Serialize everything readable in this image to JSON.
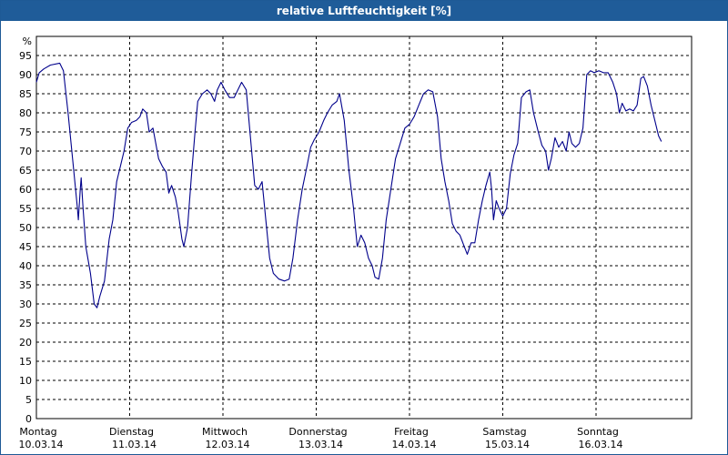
{
  "title": "relative Luftfeuchtigkeit [%]",
  "colors": {
    "titlebar": "#1f5c99",
    "line": "#00008b",
    "grid": "#000000"
  },
  "chart_data": {
    "type": "line",
    "title": "relative Luftfeuchtigkeit [%]",
    "ylabel": "%",
    "xlabel": "",
    "ylim": [
      0,
      100
    ],
    "yticks": [
      0,
      5,
      10,
      15,
      20,
      25,
      30,
      35,
      40,
      45,
      50,
      55,
      60,
      65,
      70,
      75,
      80,
      85,
      90,
      95
    ],
    "grid": true,
    "days": [
      {
        "weekday": "Montag",
        "date": "10.03.14"
      },
      {
        "weekday": "Dienstag",
        "date": "11.03.14"
      },
      {
        "weekday": "Mittwoch",
        "date": "12.03.14"
      },
      {
        "weekday": "Donnerstag",
        "date": "13.03.14"
      },
      {
        "weekday": "Freitag",
        "date": "14.03.14"
      },
      {
        "weekday": "Samstag",
        "date": "15.03.14"
      },
      {
        "weekday": "Sonntag",
        "date": "16.03.14"
      }
    ],
    "series": [
      {
        "points": [
          [
            0.0,
            88
          ],
          [
            0.03,
            90.5
          ],
          [
            0.08,
            91.5
          ],
          [
            0.15,
            92.5
          ],
          [
            0.25,
            93
          ],
          [
            0.29,
            91
          ],
          [
            0.34,
            80
          ],
          [
            0.4,
            65
          ],
          [
            0.44,
            55
          ],
          [
            0.45,
            52
          ],
          [
            0.47,
            60
          ],
          [
            0.48,
            63
          ],
          [
            0.5,
            55
          ],
          [
            0.53,
            45
          ],
          [
            0.58,
            38
          ],
          [
            0.62,
            30
          ],
          [
            0.65,
            29
          ],
          [
            0.68,
            32
          ],
          [
            0.73,
            36
          ],
          [
            0.78,
            47
          ],
          [
            0.82,
            52
          ],
          [
            0.86,
            62
          ],
          [
            0.9,
            66
          ],
          [
            0.94,
            70
          ],
          [
            0.98,
            76
          ],
          [
            1.02,
            77.5
          ],
          [
            1.07,
            78
          ],
          [
            1.11,
            79
          ],
          [
            1.14,
            81
          ],
          [
            1.18,
            80
          ],
          [
            1.21,
            75
          ],
          [
            1.25,
            76
          ],
          [
            1.28,
            72
          ],
          [
            1.31,
            68
          ],
          [
            1.35,
            66
          ],
          [
            1.39,
            64.5
          ],
          [
            1.42,
            59
          ],
          [
            1.45,
            61
          ],
          [
            1.49,
            58
          ],
          [
            1.52,
            54
          ],
          [
            1.56,
            47
          ],
          [
            1.58,
            45
          ],
          [
            1.62,
            50
          ],
          [
            1.66,
            63
          ],
          [
            1.7,
            75
          ],
          [
            1.73,
            83
          ],
          [
            1.78,
            85
          ],
          [
            1.83,
            86
          ],
          [
            1.87,
            85
          ],
          [
            1.91,
            83
          ],
          [
            1.94,
            86
          ],
          [
            1.98,
            88
          ],
          [
            2.02,
            86
          ],
          [
            2.07,
            84
          ],
          [
            2.12,
            84
          ],
          [
            2.16,
            86
          ],
          [
            2.2,
            88
          ],
          [
            2.25,
            86
          ],
          [
            2.3,
            72
          ],
          [
            2.34,
            61
          ],
          [
            2.38,
            60
          ],
          [
            2.42,
            62
          ],
          [
            2.46,
            52
          ],
          [
            2.5,
            42
          ],
          [
            2.54,
            38
          ],
          [
            2.6,
            36.5
          ],
          [
            2.66,
            36
          ],
          [
            2.71,
            36.5
          ],
          [
            2.75,
            42
          ],
          [
            2.8,
            52
          ],
          [
            2.85,
            60
          ],
          [
            2.9,
            66
          ],
          [
            2.94,
            71
          ],
          [
            2.98,
            73
          ],
          [
            3.03,
            75
          ],
          [
            3.08,
            78
          ],
          [
            3.12,
            80
          ],
          [
            3.17,
            82
          ],
          [
            3.22,
            83
          ],
          [
            3.25,
            85
          ],
          [
            3.3,
            78
          ],
          [
            3.35,
            65
          ],
          [
            3.4,
            55
          ],
          [
            3.44,
            45
          ],
          [
            3.48,
            48
          ],
          [
            3.52,
            46
          ],
          [
            3.56,
            42
          ],
          [
            3.6,
            40
          ],
          [
            3.63,
            37
          ],
          [
            3.67,
            36.5
          ],
          [
            3.71,
            42
          ],
          [
            3.75,
            52
          ],
          [
            3.8,
            60
          ],
          [
            3.85,
            68
          ],
          [
            3.9,
            72
          ],
          [
            3.95,
            76
          ],
          [
            4.0,
            77
          ],
          [
            4.05,
            79
          ],
          [
            4.1,
            82
          ],
          [
            4.15,
            85
          ],
          [
            4.2,
            86
          ],
          [
            4.25,
            85.5
          ],
          [
            4.3,
            79
          ],
          [
            4.34,
            68
          ],
          [
            4.38,
            62
          ],
          [
            4.42,
            57
          ],
          [
            4.46,
            51
          ],
          [
            4.5,
            49
          ],
          [
            4.54,
            48
          ],
          [
            4.58,
            45.5
          ],
          [
            4.62,
            43
          ],
          [
            4.66,
            46
          ],
          [
            4.7,
            46
          ],
          [
            4.74,
            52
          ],
          [
            4.78,
            57
          ],
          [
            4.82,
            61
          ],
          [
            4.86,
            64.5
          ],
          [
            4.88,
            60
          ],
          [
            4.9,
            52
          ],
          [
            4.93,
            57
          ],
          [
            4.96,
            55
          ],
          [
            5.0,
            53
          ],
          [
            5.04,
            55
          ],
          [
            5.08,
            64
          ],
          [
            5.12,
            69
          ],
          [
            5.16,
            72
          ],
          [
            5.2,
            84
          ],
          [
            5.25,
            85.5
          ],
          [
            5.29,
            86
          ],
          [
            5.33,
            80
          ],
          [
            5.38,
            75
          ],
          [
            5.42,
            71.5
          ],
          [
            5.46,
            70
          ],
          [
            5.49,
            65
          ],
          [
            5.52,
            68
          ],
          [
            5.56,
            73.5
          ],
          [
            5.6,
            71
          ],
          [
            5.64,
            72.5
          ],
          [
            5.68,
            70
          ],
          [
            5.71,
            75
          ],
          [
            5.74,
            72
          ],
          [
            5.78,
            71
          ],
          [
            5.82,
            72
          ],
          [
            5.86,
            76
          ],
          [
            5.9,
            90
          ],
          [
            5.94,
            91
          ],
          [
            5.98,
            90.5
          ],
          [
            6.03,
            91
          ],
          [
            6.08,
            90.5
          ],
          [
            6.13,
            90.5
          ],
          [
            6.18,
            88
          ],
          [
            6.22,
            85
          ],
          [
            6.25,
            80
          ],
          [
            6.28,
            82.5
          ],
          [
            6.32,
            80.5
          ],
          [
            6.36,
            81
          ],
          [
            6.4,
            80.5
          ],
          [
            6.44,
            82
          ],
          [
            6.48,
            89
          ],
          [
            6.51,
            89.5
          ],
          [
            6.55,
            87
          ],
          [
            6.59,
            82
          ],
          [
            6.63,
            78
          ],
          [
            6.67,
            74
          ],
          [
            6.7,
            72.5
          ]
        ]
      }
    ]
  }
}
